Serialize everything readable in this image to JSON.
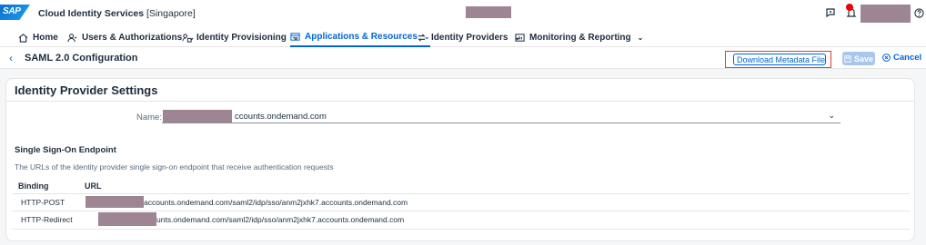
{
  "shell": {
    "logo": "SAP",
    "app_title": "Cloud Identity Services",
    "region": "[Singapore]"
  },
  "nav": [
    {
      "label": "Home",
      "icon": "home-icon",
      "has_menu": false
    },
    {
      "label": "Users & Authorizations",
      "icon": "users-icon",
      "has_menu": true
    },
    {
      "label": "Identity Provisioning",
      "icon": "provisioning-icon",
      "has_menu": true
    },
    {
      "label": "Applications & Resources",
      "icon": "applications-icon",
      "has_menu": true,
      "active": true
    },
    {
      "label": "Identity Providers",
      "icon": "identity-providers-icon",
      "has_menu": true
    },
    {
      "label": "Monitoring & Reporting",
      "icon": "monitoring-icon",
      "has_menu": true
    }
  ],
  "subheader": {
    "title": "SAML 2.0 Configuration",
    "download_label": "Download Metadata File",
    "save_label": "Save",
    "cancel_label": "Cancel"
  },
  "settings": {
    "title": "Identity Provider Settings",
    "name_label": "Name:",
    "name_value": "ccounts.ondemand.com",
    "sso_title": "Single Sign-On Endpoint",
    "sso_description": "The URLs of the identity provider single sign-on endpoint that receive authentication requests",
    "columns": [
      "Binding",
      "URL"
    ],
    "rows": [
      {
        "binding": "HTTP-POST",
        "url": "accounts.ondemand.com/saml2/idp/sso/anm2jxhk7.accounts.ondemand.com"
      },
      {
        "binding": "HTTP-Redirect",
        "url": "unts.ondemand.com/saml2/idp/sso/anm2jxhk7.accounts.ondemand.com"
      }
    ]
  },
  "colors": {
    "accent": "#0064d9",
    "highlight": "#e03c3c",
    "redaction": "#9e8593"
  }
}
